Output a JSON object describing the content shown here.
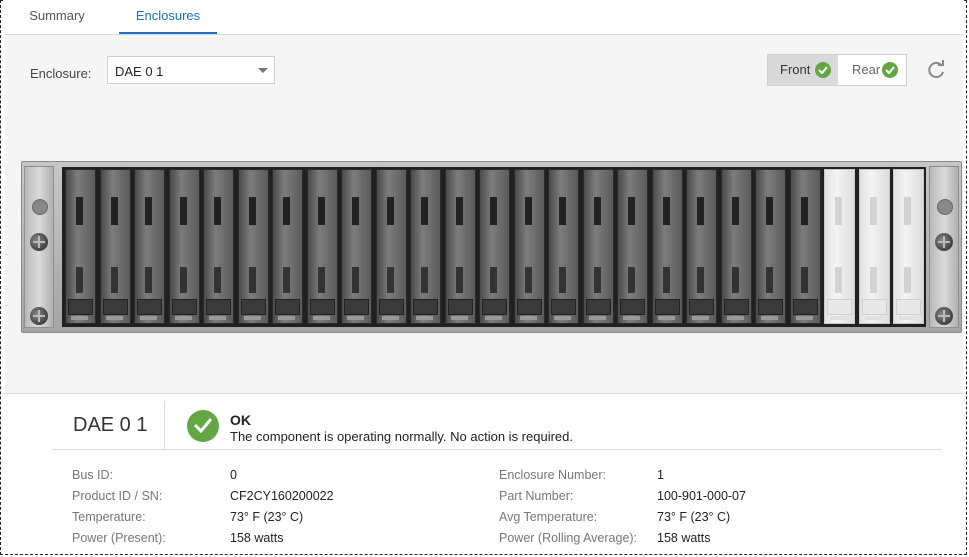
{
  "tabs": [
    {
      "label": "Summary",
      "active": false
    },
    {
      "label": "Enclosures",
      "active": true
    }
  ],
  "toolbar": {
    "enclosure_label": "Enclosure:",
    "enclosure_selected": "DAE 0 1",
    "view_toggle": {
      "front_label": "Front",
      "rear_label": "Rear",
      "active": "Front"
    },
    "refresh_icon": "refresh-icon"
  },
  "enclosure_view": {
    "populated_drive_slots": 22,
    "empty_drive_slots": 3
  },
  "details": {
    "name": "DAE 0 1",
    "status_title": "OK",
    "status_message": "The component is operating normally. No action is required.",
    "properties_left": [
      {
        "label": "Bus ID:",
        "value": "0"
      },
      {
        "label": "Product ID / SN:",
        "value": "CF2CY160200022"
      },
      {
        "label": "Temperature:",
        "value": "73° F (23° C)"
      },
      {
        "label": "Power (Present):",
        "value": "158 watts"
      }
    ],
    "properties_right": [
      {
        "label": "Enclosure Number:",
        "value": "1"
      },
      {
        "label": "Part Number:",
        "value": "100-901-000-07"
      },
      {
        "label": "Avg Temperature:",
        "value": "73° F (23° C)"
      },
      {
        "label": "Power (Rolling Average):",
        "value": "158 watts"
      }
    ]
  },
  "colors": {
    "accent": "#1a73c6",
    "ok": "#62a744"
  }
}
